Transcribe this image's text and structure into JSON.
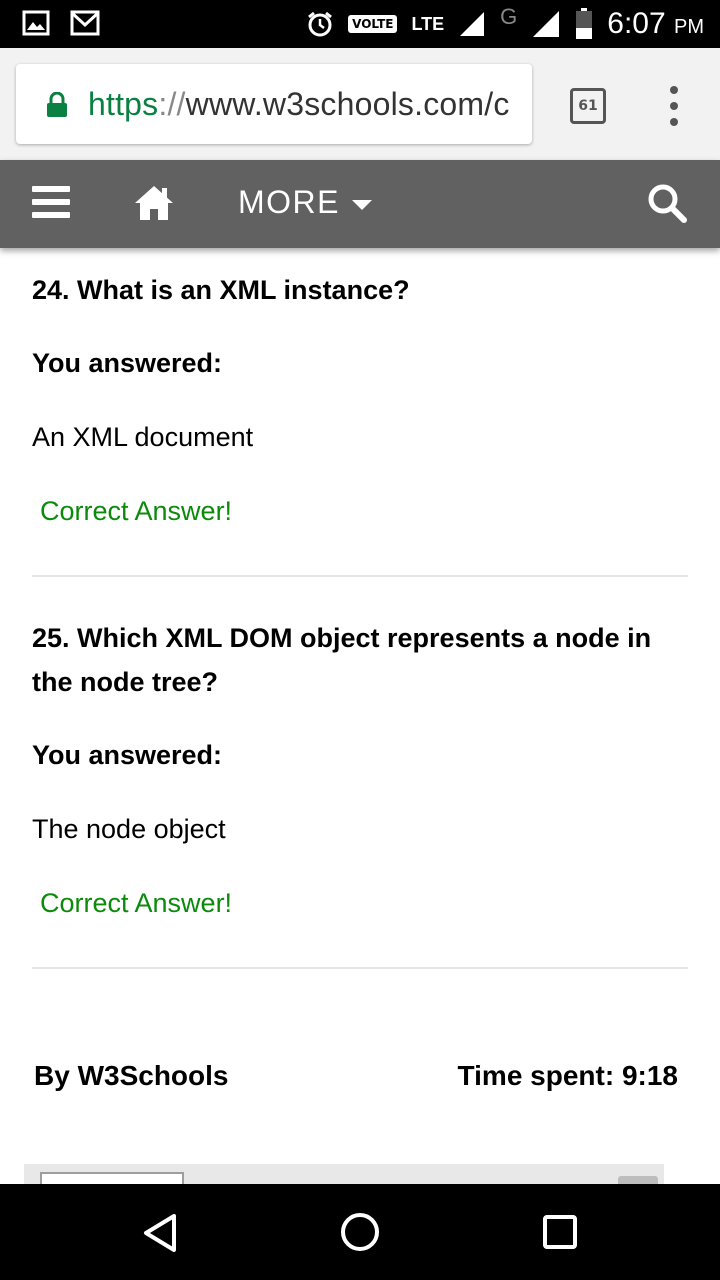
{
  "status_bar": {
    "time": "6:07",
    "ampm": "PM",
    "volte": "VOLTE",
    "lte": "LTE",
    "second_network": "G",
    "icons": [
      "image-icon",
      "gmail-icon",
      "alarm-icon",
      "signal-icon",
      "battery-icon"
    ]
  },
  "browser": {
    "url_scheme": "https",
    "url_sep": "://",
    "url_rest": "www.w3schools.com/c",
    "tab_count": "61",
    "icons": [
      "lock-icon",
      "tab-switcher-icon",
      "overflow-menu-icon"
    ]
  },
  "site_nav": {
    "more_label": "MORE",
    "icons": [
      "hamburger-menu-icon",
      "home-icon",
      "dropdown-caret-icon",
      "search-icon"
    ]
  },
  "questions": [
    {
      "title": "24. What is an XML instance?",
      "answered_label": "You answered:",
      "answer": "An XML document",
      "result": "Correct Answer!"
    },
    {
      "title": "25. Which XML DOM object represents a node in the node tree?",
      "answered_label": "You answered:",
      "answer": "The node object",
      "result": "Correct Answer!"
    }
  ],
  "footer": {
    "by": "By W3Schools",
    "time_spent": "Time spent: 9:18"
  },
  "colors": {
    "nav_background": "#616161",
    "correct_green": "#0b8a0b",
    "url_scheme_green": "#0b8043"
  },
  "android_nav": {
    "icons": [
      "back-icon",
      "home-circle-icon",
      "recents-icon"
    ]
  }
}
